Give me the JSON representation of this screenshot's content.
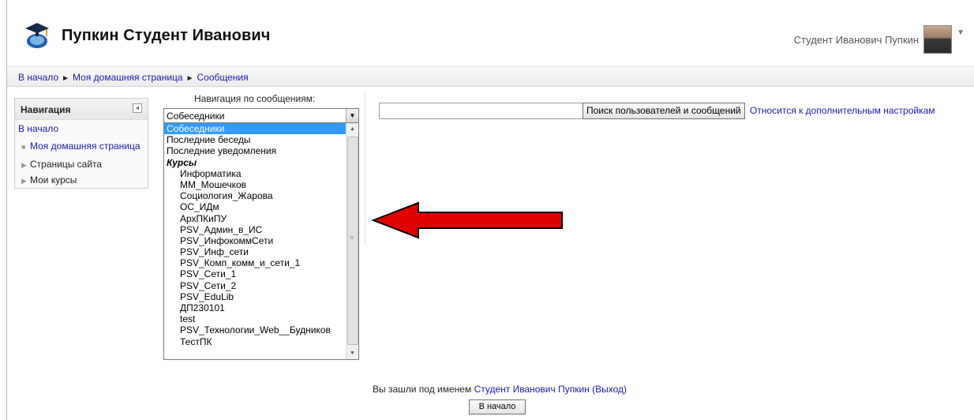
{
  "header": {
    "site_title": "Пупкин Студент Иванович",
    "user_name": "Студент Иванович Пупкин"
  },
  "breadcrumb": {
    "items": [
      "В начало",
      "Моя домашняя страница",
      "Сообщения"
    ]
  },
  "nav_block": {
    "title": "Навигация",
    "home": "В начало",
    "dashboard": "Моя домашняя страница",
    "site_pages": "Страницы сайта",
    "my_courses": "Мои курсы"
  },
  "message_nav": {
    "label": "Навигация по сообщениям:",
    "selected": "Собеседники",
    "options": [
      {
        "label": "Собеседники",
        "type": "sel"
      },
      {
        "label": "Последние беседы",
        "type": "opt"
      },
      {
        "label": "Последние уведомления",
        "type": "opt"
      },
      {
        "label": "Курсы",
        "type": "group"
      },
      {
        "label": "Информатика",
        "type": "sub"
      },
      {
        "label": "ММ_Мошечков",
        "type": "sub"
      },
      {
        "label": "Социология_Жарова",
        "type": "sub"
      },
      {
        "label": "ОС_ИДм",
        "type": "sub"
      },
      {
        "label": "АрхПКиПУ",
        "type": "sub"
      },
      {
        "label": "PSV_Админ_в_ИС",
        "type": "sub"
      },
      {
        "label": "PSV_ИнфокоммСети",
        "type": "sub"
      },
      {
        "label": "PSV_Инф_сети",
        "type": "sub"
      },
      {
        "label": "PSV_Комп_комм_и_сети_1",
        "type": "sub"
      },
      {
        "label": "PSV_Сети_1",
        "type": "sub"
      },
      {
        "label": "PSV_Сети_2",
        "type": "sub"
      },
      {
        "label": "PSV_EduLib",
        "type": "sub"
      },
      {
        "label": "ДП230101",
        "type": "sub"
      },
      {
        "label": "test",
        "type": "sub"
      },
      {
        "label": "PSV_Технологии_Web__Будников",
        "type": "sub"
      },
      {
        "label": "ТестПК",
        "type": "sub"
      }
    ]
  },
  "search": {
    "input_value": "",
    "button_label": "Поиск пользователей и сообщений",
    "advanced_link": "Относится к дополнительным настройкам"
  },
  "footer": {
    "logged_in_prefix": "Вы зашли под именем ",
    "user_link": "Студент Иванович Пупкин",
    "logout_link": "(Выход)",
    "home_button": "В начало"
  },
  "colors": {
    "link": "#1a1ab0",
    "selection": "#3399ff",
    "arrow_fill": "#e00000"
  },
  "icons": [
    "moodle-logo-icon",
    "chevron-down-icon",
    "collapse-block-icon",
    "red-arrow-annotation-icon"
  ]
}
